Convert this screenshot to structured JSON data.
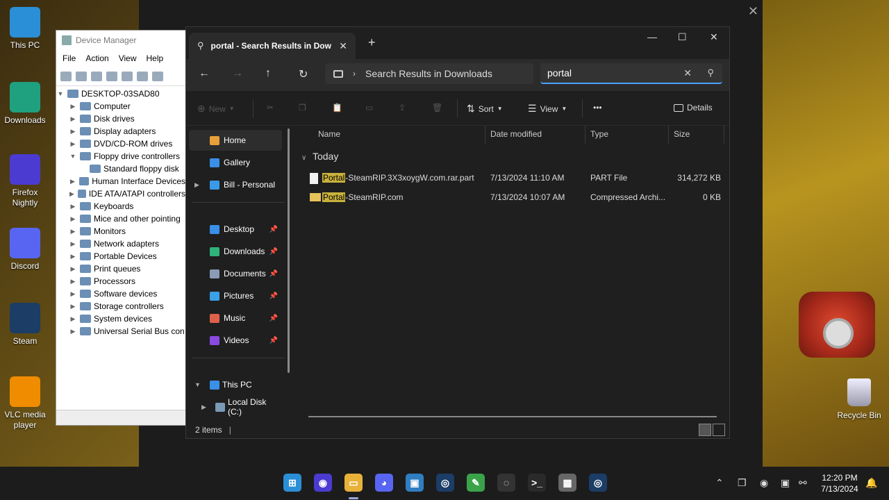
{
  "desktop": {
    "icons": [
      {
        "label": "This PC",
        "icon": "monitor-icon",
        "color": "#2a8fd6"
      },
      {
        "label": "Downloads",
        "icon": "download-folder-icon",
        "color": "#1fa07f"
      },
      {
        "label": "Firefox Nightly",
        "icon": "firefox-nightly-icon",
        "color": "#4b3bd1"
      },
      {
        "label": "Discord",
        "icon": "discord-icon",
        "color": "#5865f2"
      },
      {
        "label": "Steam",
        "icon": "steam-icon",
        "color": "#1b3d66"
      },
      {
        "label": "VLC media player",
        "icon": "vlc-icon",
        "color": "#f08c00"
      }
    ],
    "recycle_bin": "Recycle Bin"
  },
  "device_manager": {
    "title": "Device Manager",
    "menu": [
      "File",
      "Action",
      "View",
      "Help"
    ],
    "root": "DESKTOP-03SAD80",
    "nodes": [
      {
        "label": "Computer",
        "expanded": false
      },
      {
        "label": "Disk drives",
        "expanded": false
      },
      {
        "label": "Display adapters",
        "expanded": false
      },
      {
        "label": "DVD/CD-ROM drives",
        "expanded": false
      },
      {
        "label": "Floppy drive controllers",
        "expanded": true
      },
      {
        "label": "Standard floppy disk",
        "child": true
      },
      {
        "label": "Human Interface Devices",
        "expanded": false
      },
      {
        "label": "IDE ATA/ATAPI controllers",
        "expanded": false
      },
      {
        "label": "Keyboards",
        "expanded": false
      },
      {
        "label": "Mice and other pointing",
        "expanded": false
      },
      {
        "label": "Monitors",
        "expanded": false
      },
      {
        "label": "Network adapters",
        "expanded": false
      },
      {
        "label": "Portable Devices",
        "expanded": false
      },
      {
        "label": "Print queues",
        "expanded": false
      },
      {
        "label": "Processors",
        "expanded": false
      },
      {
        "label": "Software devices",
        "expanded": false
      },
      {
        "label": "Storage controllers",
        "expanded": false
      },
      {
        "label": "System devices",
        "expanded": false
      },
      {
        "label": "Universal Serial Bus con",
        "expanded": false
      }
    ]
  },
  "explorer": {
    "tab_title": "portal - Search Results in Dow",
    "breadcrumb": "Search Results in Downloads",
    "search_value": "portal",
    "commands": {
      "new": "New",
      "sort": "Sort",
      "view": "View",
      "more": "•••",
      "details": "Details"
    },
    "nav": [
      {
        "label": "Home",
        "selected": true,
        "icon": "home-icon",
        "color": "#e8a13a"
      },
      {
        "label": "Gallery",
        "icon": "gallery-icon",
        "color": "#3a8fe8"
      },
      {
        "label": "Bill - Personal",
        "icon": "onedrive-icon",
        "color": "#3a9ae8",
        "expandable": true
      },
      {
        "label": "Desktop",
        "icon": "desktop-icon",
        "color": "#3a8fe8",
        "pinned": true
      },
      {
        "label": "Downloads",
        "icon": "downloads-icon",
        "color": "#2fb37a",
        "pinned": true
      },
      {
        "label": "Documents",
        "icon": "documents-icon",
        "color": "#8a9bb5",
        "pinned": true
      },
      {
        "label": "Pictures",
        "icon": "pictures-icon",
        "color": "#3aa0e8",
        "pinned": true
      },
      {
        "label": "Music",
        "icon": "music-icon",
        "color": "#e0604a",
        "pinned": true
      },
      {
        "label": "Videos",
        "icon": "videos-icon",
        "color": "#8a4ae0",
        "pinned": true
      },
      {
        "label": "This PC",
        "icon": "this-pc-icon",
        "color": "#3a8fe8",
        "expanded": true
      },
      {
        "label": "Local Disk (C:)",
        "icon": "local-disk-icon",
        "color": "#7a9ab5",
        "expandable": true
      }
    ],
    "columns": [
      "Name",
      "Date modified",
      "Type",
      "Size"
    ],
    "group": "Today",
    "files": [
      {
        "highlight": "Portal",
        "rest": "-SteamRIP.3X3xoygW.com.rar.part",
        "date": "7/13/2024 11:10 AM",
        "type": "PART File",
        "size": "314,272 KB",
        "icon": "file-icon"
      },
      {
        "highlight": "Portal",
        "rest": "-SteamRIP.com",
        "date": "7/13/2024 10:07 AM",
        "type": "Compressed Archi...",
        "size": "0 KB",
        "icon": "zip-folder-icon"
      }
    ],
    "status": "2 items"
  },
  "taskbar": {
    "time": "12:20 PM",
    "date": "7/13/2024",
    "apps": [
      "windows-start-icon",
      "firefox-nightly-icon",
      "file-explorer-icon",
      "discord-icon",
      "virtualbox-icon",
      "steam-icon",
      "notepadpp-icon",
      "obs-icon",
      "terminal-icon",
      "device-manager-icon",
      "steam-alt-icon"
    ]
  }
}
